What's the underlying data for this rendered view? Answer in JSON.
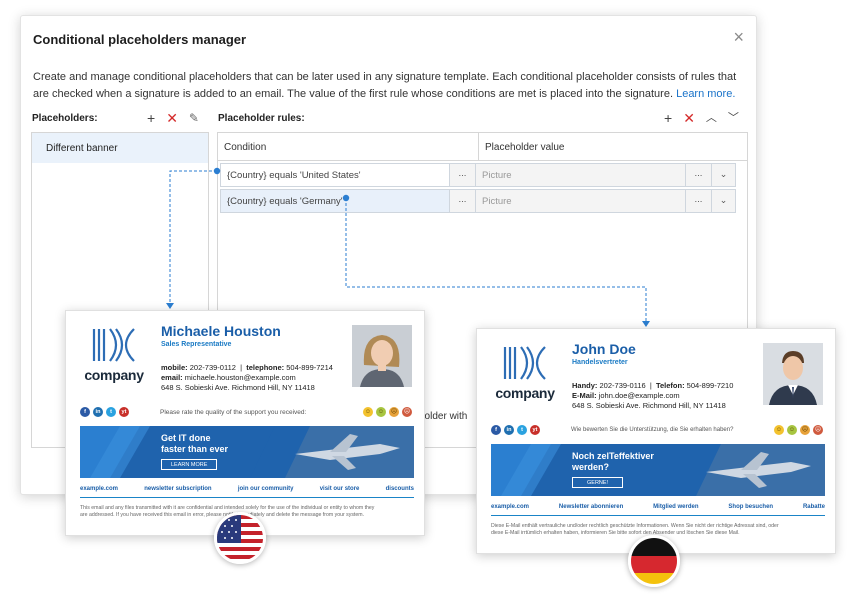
{
  "dialog": {
    "title": "Conditional placeholders manager",
    "close_glyph": "×",
    "description": "Create and manage conditional placeholders that can be later used in any signature template. Each conditional placeholder consists of rules that are checked when a signature is added to an email. The value of the first rule whose conditions are met is placed into the signature.",
    "learn_more": "Learn more.",
    "placeholders_label": "Placeholders:",
    "rules_label": "Placeholder rules:",
    "partial_text": "holder with"
  },
  "placeholders": [
    {
      "label": "Different banner"
    }
  ],
  "rules": {
    "columns": {
      "condition": "Condition",
      "value": "Placeholder value"
    },
    "rows": [
      {
        "condition": "{Country} equals 'United States'",
        "value": "Picture",
        "dots": "...",
        "dropdown": "⌄"
      },
      {
        "condition": "{Country} equals 'Germany'",
        "value": "Picture",
        "dots": "...",
        "dropdown": "⌄"
      }
    ]
  },
  "toolbar": {
    "add": "+",
    "remove": "✕",
    "edit": "✎",
    "up": "︿",
    "down": "﹀"
  },
  "icons": {
    "add": "plus-icon",
    "remove": "x-icon",
    "edit": "edit-icon",
    "up": "chevron-up-icon",
    "down": "chevron-down-icon",
    "close": "close-icon"
  },
  "colors": {
    "accent": "#1a73c9",
    "remove": "#d42a2a",
    "signature_blue": "#1a5ea8",
    "connector": "#2b7ed1"
  },
  "signature_us": {
    "logo_text": "company",
    "name": "Michaele Houston",
    "role": "Sales Representative",
    "mobile_label": "mobile:",
    "mobile": "202-739-0112",
    "phone_label": "telephone:",
    "phone": "504-899-7214",
    "email_label": "email:",
    "email": "michaele.houston@example.com",
    "address": "648 S. Sobieski Ave. Richmond Hill, NY 11418",
    "social": [
      "f",
      "in",
      "t",
      "yt"
    ],
    "rating_text": "Please rate the quality of the support you received:",
    "banner_title_1": "Get IT done",
    "banner_title_2": "faster than ever",
    "banner_button": "LEARN MORE",
    "links": [
      "example.com",
      "newsletter subscription",
      "join our community",
      "visit our store",
      "discounts"
    ],
    "disclaimer_1": "This email and any files transmitted with it are confidential and intended solely for the use of the individual or entity to whom they",
    "disclaimer_2": "are addressed. If you have received this email in error, please notify immediately and delete the message from your system."
  },
  "signature_de": {
    "logo_text": "company",
    "name": "John Doe",
    "role": "Handelsvertreter",
    "mobile_label": "Handy:",
    "mobile": "202-739-0116",
    "phone_label": "Telefon:",
    "phone": "504-899-7210",
    "email_label": "E-Mail:",
    "email": "john.doe@example.com",
    "address": "648 S. Sobieski Ave. Richmond Hill, NY 11418",
    "social": [
      "f",
      "in",
      "t",
      "yt"
    ],
    "rating_text": "Wie bewerten Sie die Unterstützung, die Sie erhalten haben?",
    "banner_title_1": "Noch zelTeffektiver",
    "banner_title_2": "werden?",
    "banner_button": "GERNE!",
    "links": [
      "example.com",
      "Newsletter abonnieren",
      "Mitglied werden",
      "Shop besuchen",
      "Rabatte"
    ],
    "disclaimer_1": "Diese E-Mail enthält vertrauliche und/oder rechtlich geschützte Informationen. Wenn Sie nicht der richtige Adressat sind, oder",
    "disclaimer_2": "diese E-Mail irrtümlich erhalten haben, informieren Sie bitte sofort den Absender und löschen Sie diese Mail."
  }
}
